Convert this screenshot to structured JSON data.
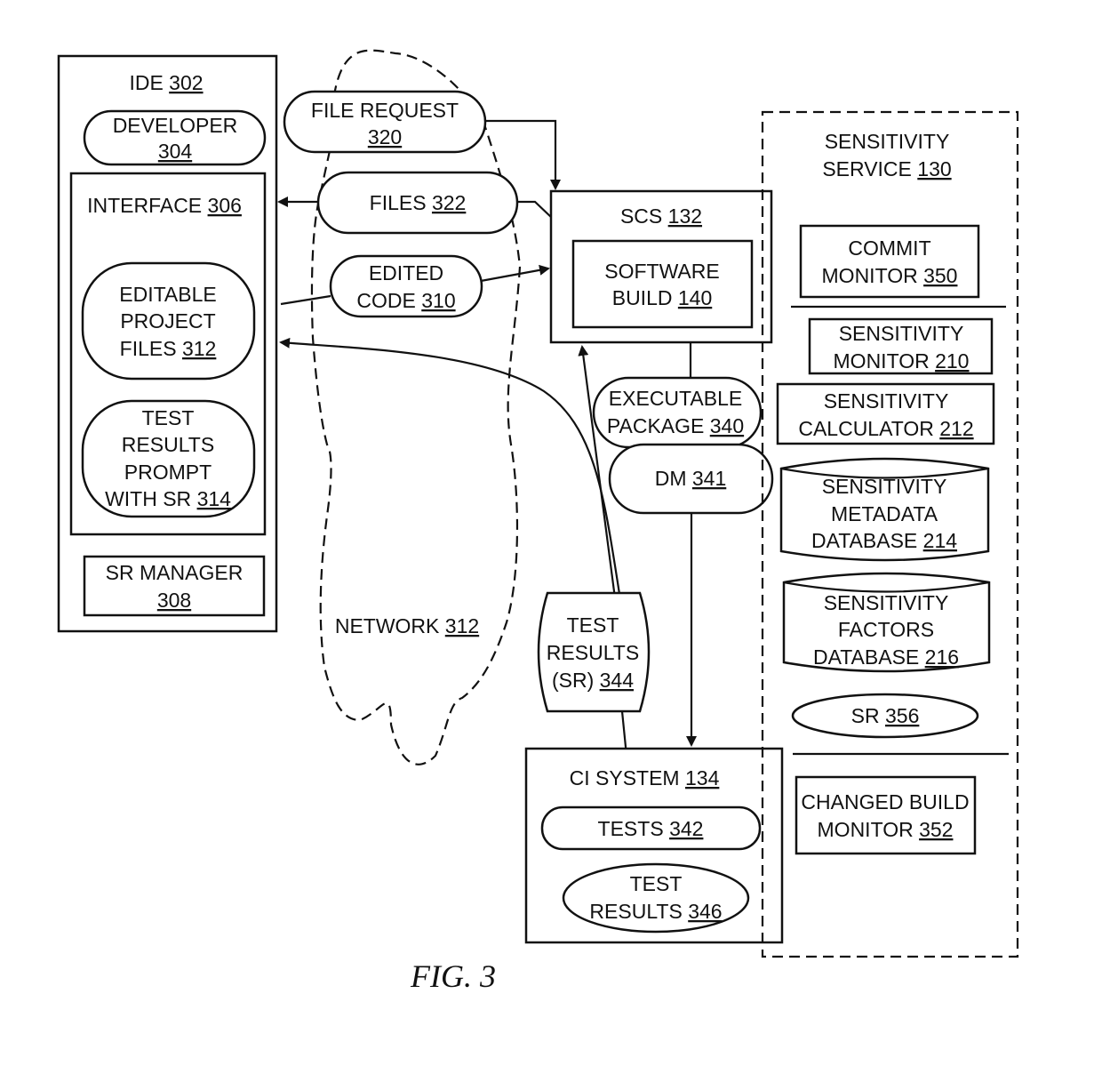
{
  "figure_caption": "FIG. 3",
  "ide": {
    "title": "IDE",
    "ref": "302",
    "developer": {
      "lines": [
        "DEVELOPER"
      ],
      "ref": "304"
    },
    "interface": {
      "title": "INTERFACE",
      "ref": "306",
      "editable_project_files": {
        "lines": [
          "EDITABLE",
          "PROJECT",
          "FILES"
        ],
        "ref": "312"
      },
      "test_results_prompt": {
        "lines": [
          "TEST",
          "RESULTS",
          "PROMPT",
          "WITH SR"
        ],
        "ref": "314"
      }
    },
    "sr_manager": {
      "lines": [
        "SR MANAGER"
      ],
      "ref": "308"
    }
  },
  "network": {
    "label": "NETWORK",
    "ref": "312"
  },
  "messages": {
    "file_request": {
      "lines": [
        "FILE REQUEST"
      ],
      "ref": "320"
    },
    "files": {
      "label": "FILES",
      "ref": "322"
    },
    "edited_code": {
      "lines": [
        "EDITED",
        "CODE"
      ],
      "ref": "310"
    },
    "executable_package": {
      "lines": [
        "EXECUTABLE",
        "PACKAGE"
      ],
      "ref": "340"
    },
    "dm": {
      "label": "DM",
      "ref": "341"
    },
    "test_results_sr": {
      "lines": [
        "TEST",
        "RESULTS",
        "(SR)"
      ],
      "ref": "344"
    }
  },
  "scs": {
    "title": "SCS",
    "ref": "132",
    "software_build": {
      "lines": [
        "SOFTWARE",
        "BUILD"
      ],
      "ref": "140"
    }
  },
  "ci_system": {
    "title": "CI SYSTEM",
    "ref": "134",
    "tests": {
      "label": "TESTS",
      "ref": "342"
    },
    "test_results": {
      "lines": [
        "TEST",
        "RESULTS"
      ],
      "ref": "346"
    }
  },
  "sensitivity_service": {
    "title_lines": [
      "SENSITIVITY",
      "SERVICE"
    ],
    "ref": "130",
    "commit_monitor": {
      "lines": [
        "COMMIT",
        "MONITOR"
      ],
      "ref": "350"
    },
    "sensitivity_monitor": {
      "lines": [
        "SENSITIVITY",
        "MONITOR"
      ],
      "ref": "210"
    },
    "sensitivity_calculator": {
      "lines": [
        "SENSITIVITY",
        "CALCULATOR"
      ],
      "ref": "212"
    },
    "metadata_db": {
      "lines": [
        "SENSITIVITY",
        "METADATA",
        "DATABASE"
      ],
      "ref": "214"
    },
    "factors_db": {
      "lines": [
        "SENSITIVITY",
        "FACTORS",
        "DATABASE"
      ],
      "ref": "216"
    },
    "sr": {
      "label": "SR",
      "ref": "356"
    },
    "changed_build_monitor": {
      "lines": [
        "CHANGED BUILD",
        "MONITOR"
      ],
      "ref": "352"
    }
  }
}
